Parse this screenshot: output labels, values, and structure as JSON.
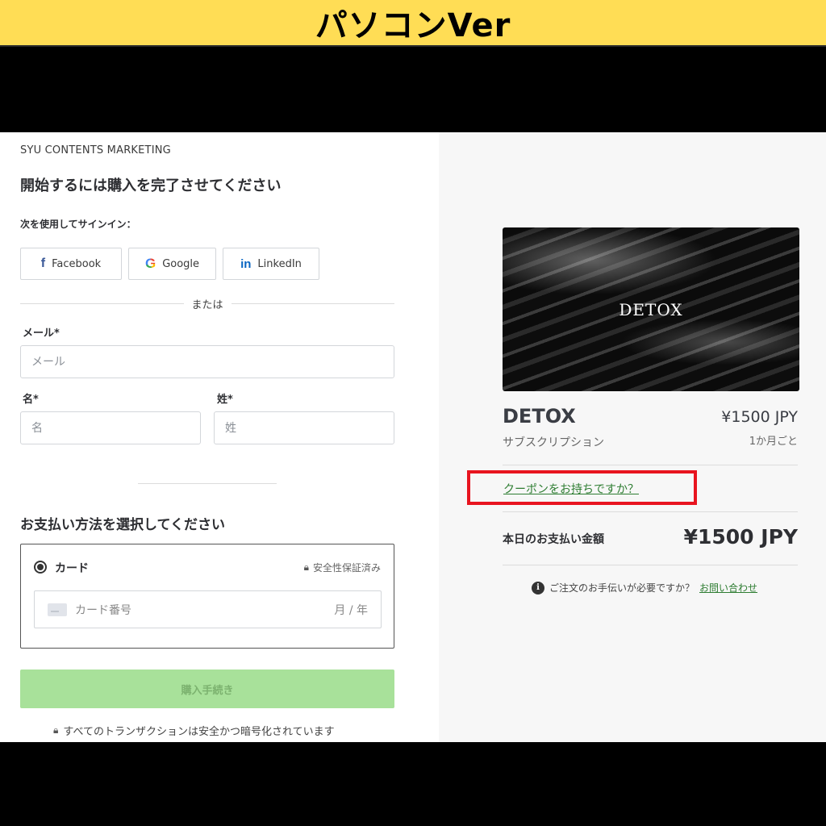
{
  "banner": {
    "title": "パソコンVer"
  },
  "checkout": {
    "brand": "SYU CONTENTS MARKETING",
    "heading": "開始するには購入を完了させてください",
    "signin_label": "次を使用してサインイン：",
    "social": {
      "facebook_label": "Facebook",
      "google_label": "Google",
      "linkedin_label": "LinkedIn"
    },
    "or_text": "または",
    "email": {
      "label": "メール*",
      "placeholder": "メール"
    },
    "first_name": {
      "label": "名*",
      "placeholder": "名"
    },
    "last_name": {
      "label": "姓*",
      "placeholder": "姓"
    },
    "payment_heading": "お支払い方法を選択してください",
    "payment": {
      "method_label": "カード",
      "secure_label": "安全性保証済み",
      "card_placeholder": "カード番号",
      "expiry_placeholder": "月 / 年"
    },
    "purchase_button": "購入手続き",
    "secure_footer": "すべてのトランザクションは安全かつ暗号化されています"
  },
  "summary": {
    "image_text": "DETOX",
    "product_name": "DETOX",
    "price": "¥1500 JPY",
    "type": "サブスクリプション",
    "period": "1か月ごと",
    "coupon_link": "クーポンをお持ちですか？",
    "total_label": "本日のお支払い金額",
    "total_amount": "¥1500 JPY",
    "help_text": "ご注文のお手伝いが必要ですか？",
    "contact_link": "お問い合わせ"
  },
  "colors": {
    "banner_bg": "#ffdd55",
    "coupon_highlight": "#e8141f",
    "link_green": "#2e7d32",
    "purchase_button_bg": "#a8e19a"
  },
  "icons": [
    "facebook-icon",
    "google-icon",
    "linkedin-icon",
    "lock-icon",
    "card-icon",
    "info-icon",
    "radio-selected-icon"
  ]
}
